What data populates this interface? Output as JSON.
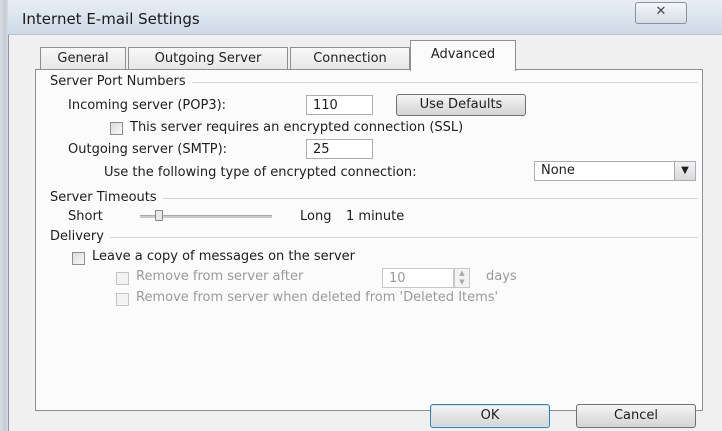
{
  "window": {
    "title": "Internet E-mail Settings",
    "close_glyph": "✕"
  },
  "tabs": [
    {
      "label": "General"
    },
    {
      "label": "Outgoing Server"
    },
    {
      "label": "Connection"
    },
    {
      "label": "Advanced",
      "active": true
    }
  ],
  "server_ports": {
    "group_label": "Server Port Numbers",
    "incoming_label": "Incoming server (POP3):",
    "incoming_value": "110",
    "use_defaults_label": "Use Defaults",
    "ssl_checkbox_label": "This server requires an encrypted connection (SSL)",
    "ssl_checked": false,
    "outgoing_label": "Outgoing server (SMTP):",
    "outgoing_value": "25",
    "encryption_label": "Use the following type of encrypted connection:",
    "encryption_value": "None"
  },
  "timeouts": {
    "group_label": "Server Timeouts",
    "short_label": "Short",
    "long_label": "Long",
    "value_label": "1 minute"
  },
  "delivery": {
    "group_label": "Delivery",
    "leave_copy_label": "Leave a copy of messages on the server",
    "leave_copy_checked": false,
    "remove_after_label": "Remove from server after",
    "remove_after_value": "10",
    "days_label": "days",
    "remove_deleted_label": "Remove from server when deleted from 'Deleted Items'"
  },
  "footer": {
    "ok_label": "OK",
    "cancel_label": "Cancel"
  },
  "icons": {
    "dropdown": "chevron-down-icon",
    "spinner": "spin-updown-icon"
  }
}
